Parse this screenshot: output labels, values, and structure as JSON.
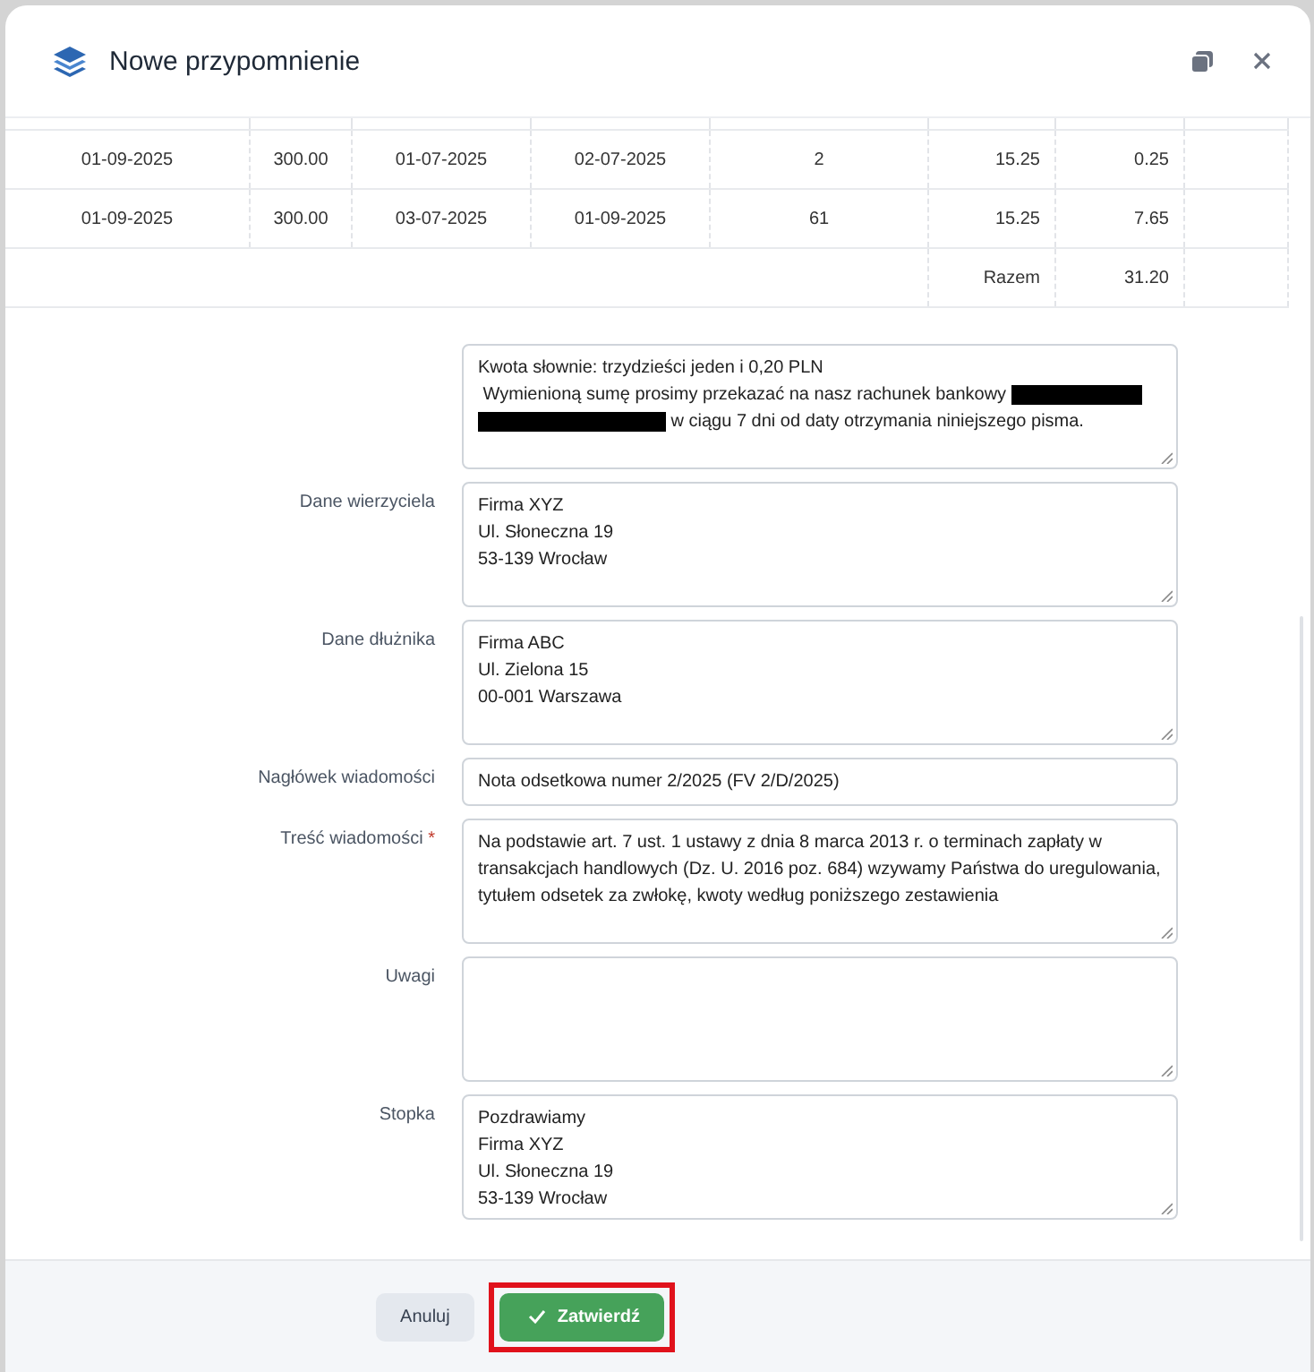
{
  "window": {
    "title": "Nowe przypomnienie"
  },
  "table": {
    "rows": [
      {
        "cells": [
          "01-09-2025",
          "300.00",
          "01-07-2025",
          "02-07-2025",
          "2",
          "15.25",
          "0.25"
        ]
      },
      {
        "cells": [
          "01-09-2025",
          "300.00",
          "03-07-2025",
          "01-09-2025",
          "61",
          "15.25",
          "7.65"
        ]
      }
    ],
    "total_label": "Razem",
    "total_value": "31.20"
  },
  "fields": [
    {
      "kind": "textarea",
      "lines": [
        [
          {
            "kind": "text",
            "text": "Kwota słownie: trzydzieści jeden i 0,20 PLN"
          }
        ],
        [
          {
            "kind": "text",
            "text": " Wymienioną sumę prosimy przekazać na nasz rachunek bankowy "
          },
          {
            "kind": "redaction"
          }
        ],
        [
          {
            "kind": "redaction"
          },
          {
            "kind": "text",
            "text": " w ciągu 7 dni od daty otrzymania niniejszego pisma."
          }
        ]
      ]
    },
    {
      "kind": "textarea",
      "label": "Dane wierzyciela",
      "value": "Firma XYZ\nUl. Słoneczna 19\n53-139 Wrocław"
    },
    {
      "kind": "textarea",
      "label": "Dane dłużnika",
      "value": "Firma ABC\nUl. Zielona 15\n00-001 Warszawa"
    },
    {
      "kind": "input",
      "label": "Nagłówek wiadomości",
      "value": "Nota odsetkowa numer 2/2025 (FV 2/D/2025)"
    },
    {
      "kind": "textarea",
      "label": "Treść wiadomości",
      "marker": "*",
      "value": "Na podstawie art. 7 ust. 1 ustawy z dnia 8 marca 2013 r. o terminach zapłaty w transakcjach handlowych (Dz. U. 2016 poz. 684) wzywamy Państwa do uregulowania, tytułem odsetek za zwłokę, kwoty według poniższego zestawienia"
    },
    {
      "kind": "textarea",
      "label": "Uwagi"
    },
    {
      "kind": "textarea",
      "label": "Stopka",
      "value": "Pozdrawiamy\nFirma XYZ\nUl. Słoneczna 19\n53-139 Wrocław"
    }
  ],
  "buttons": [
    {
      "kind": "cancel",
      "label": "Anuluj",
      "highlighted": false
    },
    {
      "kind": "confirm",
      "label": "Zatwierdź",
      "highlighted": true
    }
  ]
}
